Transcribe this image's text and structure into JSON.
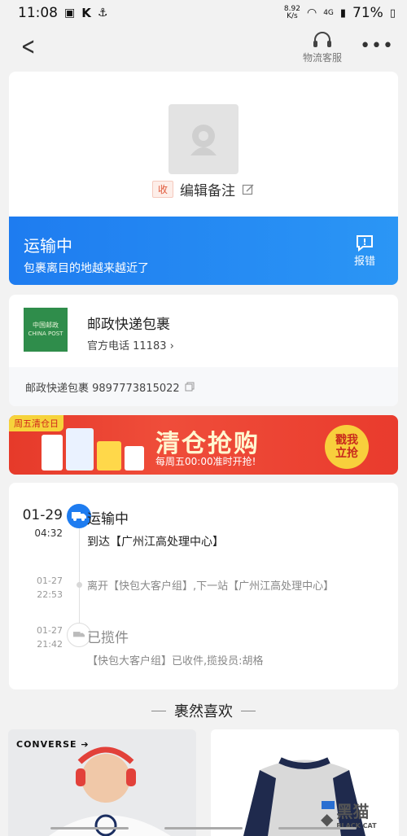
{
  "status_bar": {
    "time": "11:08",
    "speed_value": "8.92",
    "speed_unit": "K/s",
    "network": "4G",
    "battery": "71%"
  },
  "nav": {
    "service_label": "物流客服"
  },
  "package": {
    "tag": "收",
    "note_label": "编辑备注"
  },
  "status": {
    "title": "运输中",
    "subtitle": "包裹离目的地越来越近了",
    "report_label": "报错"
  },
  "courier": {
    "logo_line1": "中国邮政",
    "logo_line2": "CHINA POST",
    "name": "邮政快递包裹",
    "phone_label": "官方电话 11183",
    "tracking_text": "邮政快递包裹 9897773815022"
  },
  "banner": {
    "tag": "周五清仓日",
    "headline": "清仓抢购",
    "subline": "每周五00:00准时开抢!",
    "button": "戳我立抢"
  },
  "timeline": [
    {
      "date": "01-29",
      "time": "04:32",
      "status": "运输中",
      "detail": "到达【广州江高处理中心】"
    },
    {
      "date": "01-27",
      "time": "22:53",
      "status": "",
      "detail": "离开【快包大客户组】,下一站【广州江高处理中心】"
    },
    {
      "date": "01-27",
      "time": "21:42",
      "status": "已揽件",
      "detail": "【快包大客户组】已收件,揽投员:胡格"
    }
  ],
  "recommend": {
    "title": "裹然喜欢",
    "brand": "CONVERSE"
  },
  "watermark": {
    "text": "黑猫",
    "sub": "BLACK CAT"
  },
  "colors": {
    "accent": "#1e7cf0",
    "banner_red": "#e63a2a"
  }
}
